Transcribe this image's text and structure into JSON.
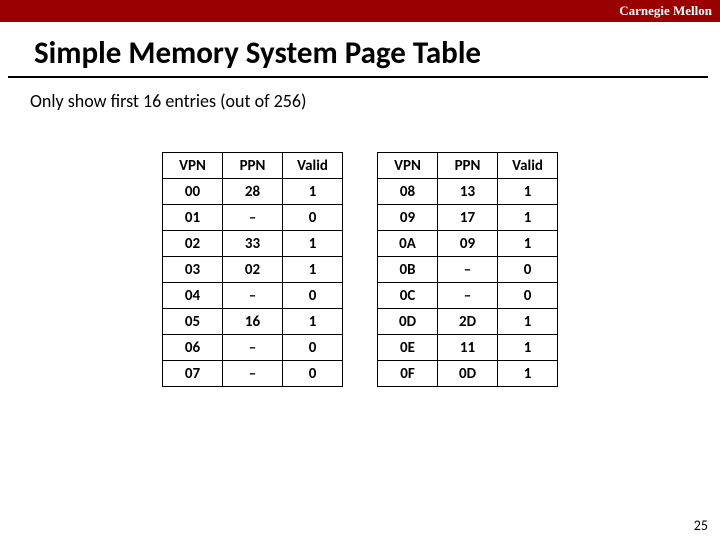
{
  "brand": "Carnegie Mellon",
  "title": "Simple Memory System Page Table",
  "subtitle": "Only show first 16 entries (out of 256)",
  "headers": [
    "VPN",
    "PPN",
    "Valid"
  ],
  "left_rows": [
    {
      "vpn": "00",
      "ppn": "28",
      "valid": "1"
    },
    {
      "vpn": "01",
      "ppn": "–",
      "valid": "0"
    },
    {
      "vpn": "02",
      "ppn": "33",
      "valid": "1"
    },
    {
      "vpn": "03",
      "ppn": "02",
      "valid": "1"
    },
    {
      "vpn": "04",
      "ppn": "–",
      "valid": "0"
    },
    {
      "vpn": "05",
      "ppn": "16",
      "valid": "1"
    },
    {
      "vpn": "06",
      "ppn": "–",
      "valid": "0"
    },
    {
      "vpn": "07",
      "ppn": "–",
      "valid": "0"
    }
  ],
  "right_rows": [
    {
      "vpn": "08",
      "ppn": "13",
      "valid": "1"
    },
    {
      "vpn": "09",
      "ppn": "17",
      "valid": "1"
    },
    {
      "vpn": "0A",
      "ppn": "09",
      "valid": "1"
    },
    {
      "vpn": "0B",
      "ppn": "–",
      "valid": "0"
    },
    {
      "vpn": "0C",
      "ppn": "–",
      "valid": "0"
    },
    {
      "vpn": "0D",
      "ppn": "2D",
      "valid": "1"
    },
    {
      "vpn": "0E",
      "ppn": "11",
      "valid": "1"
    },
    {
      "vpn": "0F",
      "ppn": "0D",
      "valid": "1"
    }
  ],
  "page_number": "25"
}
